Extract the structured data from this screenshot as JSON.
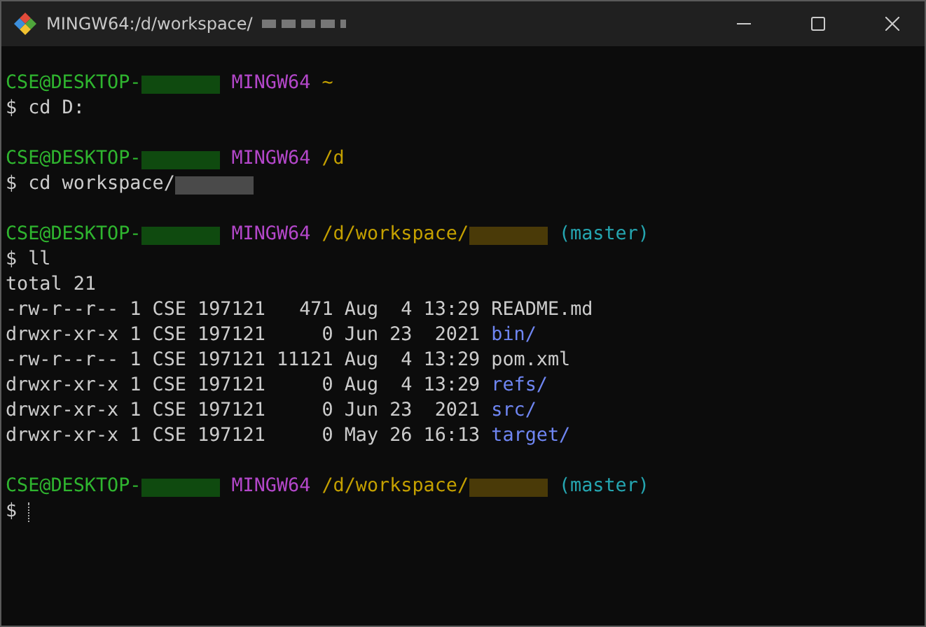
{
  "window": {
    "title": "MINGW64:/d/workspace/",
    "title_redacted": true
  },
  "blocks": [
    {
      "lines": [
        [
          {
            "kind": "user",
            "text": "CSE@DESKTOP-"
          },
          {
            "kind": "redacted",
            "color": "#0f4a0f"
          },
          {
            "kind": "system",
            "text": "MINGW64"
          },
          {
            "kind": "path",
            "text": "~"
          }
        ],
        [
          {
            "kind": "plain",
            "text": "$ cd D:"
          }
        ]
      ]
    },
    {
      "lines": [
        [
          {
            "kind": "user",
            "text": "CSE@DESKTOP-"
          },
          {
            "kind": "redacted",
            "color": "#0f4a0f"
          },
          {
            "kind": "system",
            "text": "MINGW64"
          },
          {
            "kind": "path",
            "text": "/d"
          }
        ],
        [
          {
            "kind": "plain",
            "text": "$ cd workspace/"
          },
          {
            "kind": "redacted",
            "color": "#4a4a4a"
          }
        ]
      ]
    },
    {
      "lines": [
        [
          {
            "kind": "user",
            "text": "CSE@DESKTOP-"
          },
          {
            "kind": "redacted",
            "color": "#0f4a0f"
          },
          {
            "kind": "system",
            "text": "MINGW64"
          },
          {
            "kind": "path",
            "text": "/d/workspace/"
          },
          {
            "kind": "redacted",
            "color": "#4a3a08"
          },
          {
            "kind": "branch",
            "text": "(master)"
          }
        ],
        [
          {
            "kind": "plain",
            "text": "$ ll"
          }
        ],
        [
          {
            "kind": "plain",
            "text": "total 21"
          }
        ],
        [
          {
            "kind": "plain",
            "text": "-rw-r--r-- 1 CSE 197121   471 Aug  4 13:29 "
          },
          {
            "kind": "file",
            "text": "README.md"
          }
        ],
        [
          {
            "kind": "plain",
            "text": "drwxr-xr-x 1 CSE 197121     0 Jun 23  2021 "
          },
          {
            "kind": "dir",
            "text": "bin/"
          }
        ],
        [
          {
            "kind": "plain",
            "text": "-rw-r--r-- 1 CSE 197121 11121 Aug  4 13:29 "
          },
          {
            "kind": "file",
            "text": "pom.xml"
          }
        ],
        [
          {
            "kind": "plain",
            "text": "drwxr-xr-x 1 CSE 197121     0 Aug  4 13:29 "
          },
          {
            "kind": "dir",
            "text": "refs/"
          }
        ],
        [
          {
            "kind": "plain",
            "text": "drwxr-xr-x 1 CSE 197121     0 Jun 23  2021 "
          },
          {
            "kind": "dir",
            "text": "src/"
          }
        ],
        [
          {
            "kind": "plain",
            "text": "drwxr-xr-x 1 CSE 197121     0 May 26 16:13 "
          },
          {
            "kind": "dir",
            "text": "target/"
          }
        ]
      ]
    },
    {
      "lines": [
        [
          {
            "kind": "user",
            "text": "CSE@DESKTOP-"
          },
          {
            "kind": "redacted",
            "color": "#0f4a0f"
          },
          {
            "kind": "system",
            "text": "MINGW64"
          },
          {
            "kind": "path",
            "text": "/d/workspace/"
          },
          {
            "kind": "redacted",
            "color": "#4a3a08"
          },
          {
            "kind": "branch",
            "text": "(master)"
          }
        ],
        [
          {
            "kind": "plain",
            "text": "$ "
          },
          {
            "kind": "cursor"
          }
        ]
      ]
    }
  ]
}
